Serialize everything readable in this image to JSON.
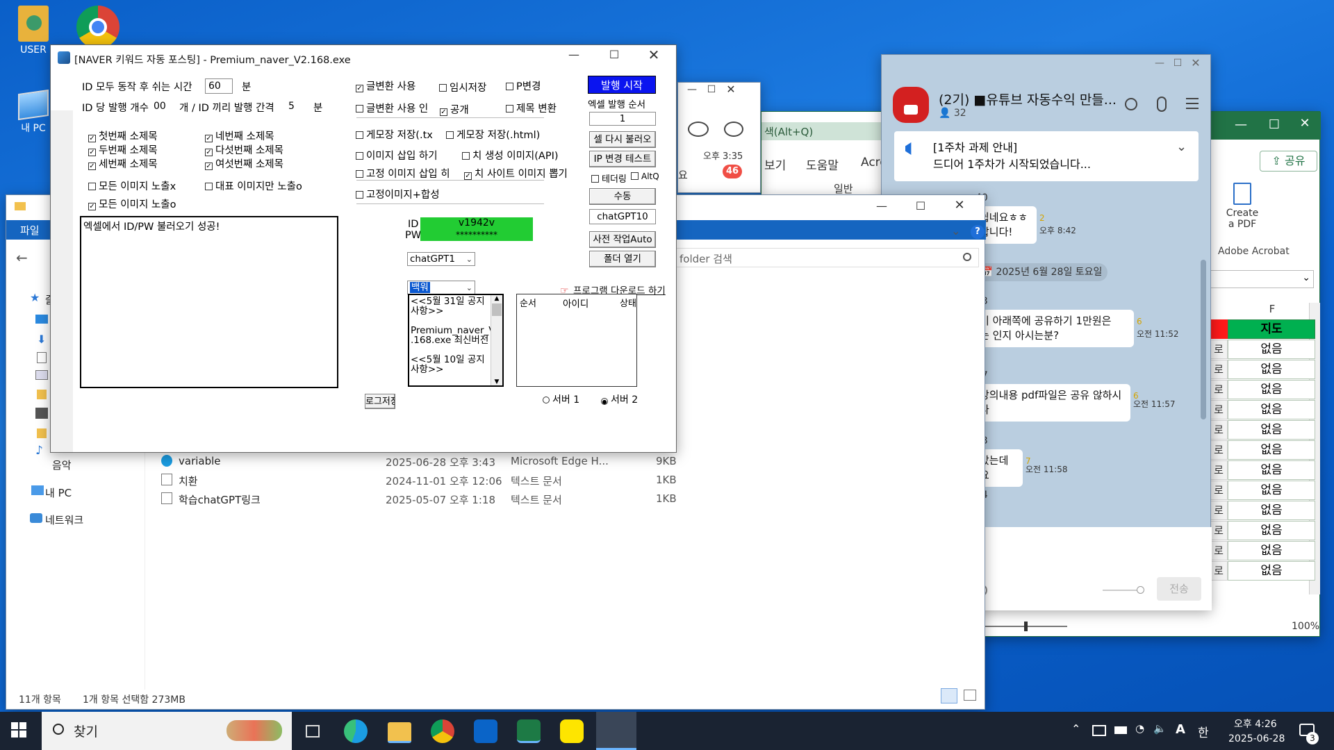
{
  "desktop": {
    "icons": [
      {
        "label": "USER"
      },
      {
        "label": "내 PC"
      }
    ]
  },
  "explorer": {
    "tab_file": "파일",
    "search_placeholder": "folder 검색",
    "side_items": {
      "music": "음악",
      "pc": "내 PC",
      "network": "네트워크",
      "star": "즐"
    },
    "files": [
      {
        "name": "variable",
        "date": "2025-06-28 오후 3:43",
        "type": "Microsoft Edge H...",
        "size": "9KB"
      },
      {
        "name": "치환",
        "date": "2024-11-01 오후 12:06",
        "type": "텍스트 문서",
        "size": "1KB"
      },
      {
        "name": "학습chatGPT링크",
        "date": "2025-05-07 오후 1:18",
        "type": "텍스트 문서",
        "size": "1KB"
      }
    ],
    "status_count": "11개 항목",
    "status_selected": "1개 항목 선택함 273MB"
  },
  "excel": {
    "search_text": "색(Alt+Q)",
    "menu": [
      "보기",
      "도움말",
      "Acro"
    ],
    "share": "공유",
    "create_pdf": "Create\na PDF",
    "create_pdf_1": "Create",
    "create_pdf_2": "a PDF",
    "adobe": "Adobe Acrobat",
    "format": "일반",
    "col_f": "F",
    "header": "지도",
    "left_chars": [
      "로",
      "로",
      "로",
      "로",
      "로",
      "로",
      "로",
      "로",
      "로",
      "로",
      "로",
      "로"
    ],
    "rows": [
      "없음",
      "없음",
      "없음",
      "없음",
      "없음",
      "없음",
      "없음",
      "없음",
      "없음",
      "없음",
      "없음",
      "없음"
    ],
    "zoom": "100%"
  },
  "kakao_small": {
    "time": "오후 3:35",
    "badge": "46",
    "fragment": "요"
  },
  "kakao": {
    "title": "(2기) ■유튜브 자동수익 만들...",
    "members": "32",
    "notice_line1": "[1주차 과제 안내]",
    "notice_line2": "드디어 1주차가 시작되었습니다...",
    "date": "2025년 6월 28일 토요일",
    "messages": [
      {
        "num": "40",
        "text1": "쉽네요ㅎㅎ",
        "text2": "합니다!",
        "read": "2",
        "time": "오후 8:42"
      },
      {
        "num": "73",
        "text1": "기 아래쪽에 공유하기 1만원은",
        "text2": "는 인지 아시는분?",
        "read": "6",
        "time": "오전 11:52"
      },
      {
        "num": "67",
        "text1": "강의내용 pdf파일은 공유 않하시나",
        "text2": "",
        "read": "6",
        "time": "오전 11:57"
      },
      {
        "num": "73",
        "text1": "았는데요",
        "text2": "",
        "read": "7",
        "time": "오전 11:58"
      },
      {
        "num": "04",
        "text1": "",
        "text2": "",
        "read": "",
        "time": ""
      }
    ],
    "send": "전송"
  },
  "app": {
    "title": "[NAVER 키워드 자동 포스팅] - Premium_naver_V2.168.exe",
    "rest_label": "ID 모두 동작 후 쉬는 시간",
    "rest_value": "60",
    "rest_unit": "분",
    "count_label": "ID 당 발행 개수",
    "count_value": "00",
    "count_unit": "개 / ID 끼리 발행 간격",
    "interval_value": "5",
    "interval_unit": "분",
    "subtitles": [
      "첫번째 소제목",
      "두번째 소제목",
      "세번째 소제목",
      "네번째 소제목",
      "다섯번째 소제목",
      "여섯번째 소제목"
    ],
    "img_expose_x": "모든 이미지 노출x",
    "img_rep_only": "대표 이미지만 노출o",
    "img_expose_o": "모든 이미지 노출o",
    "opt_convert": "글변환 사용",
    "opt_convert_in": "글변환 사용 인",
    "opt_temp": "임시저장",
    "opt_public": "공개",
    "opt_p": "P변경",
    "opt_title": "제목 변환",
    "opt_save_txt": "게모장 저장(.tx",
    "opt_save_html": "게모장 저장(.html)",
    "opt_img_insert": "이미지 삽입 하기",
    "opt_ai_img": "치 생성 이미지(API)",
    "opt_fixed_img": "고정 이미지 삽입 히",
    "opt_site_img": "치 사이트 이미지 뽑기",
    "opt_fixed_synth": "고정이미지+합성",
    "log": "엑셀에서 ID/PW 불러오기 성공!",
    "id_label": "ID",
    "pw_label": "PW",
    "id_value": "v1942v",
    "pw_value": "**********",
    "gpt_select": "chatGPT1",
    "select2": "백워",
    "btn_start": "발행 시작",
    "excel_order": "엑셀 발행 순서",
    "order_value": "1",
    "btn_reload": "셀 다시 불러오",
    "btn_ip": "IP 변경 테스트",
    "opt_tether": "테더링",
    "opt_altq": "AltQ",
    "btn_manual": "수동",
    "gpt_value": "chatGPT10",
    "btn_pre": "사전 작업Auto",
    "btn_folder": "폴더 열기",
    "download_link": "프로그램 다운로드 하기",
    "notice": [
      "<<5월 31일 공지",
      "사항>>",
      "",
      "Premium_naver_V2",
      ".168.exe 최신버전",
      "",
      "<<5월 10일 공지",
      "사항>>"
    ],
    "list_cols": [
      "순서",
      "아이디",
      "상태"
    ],
    "server1": "서버 1",
    "server2": "서버 2",
    "log_save": "로그저장"
  },
  "taskbar": {
    "search": "찾기",
    "time": "오후 4:26",
    "date": "2025-06-28",
    "ime": "한",
    "ime2": "A",
    "notif": "3"
  }
}
